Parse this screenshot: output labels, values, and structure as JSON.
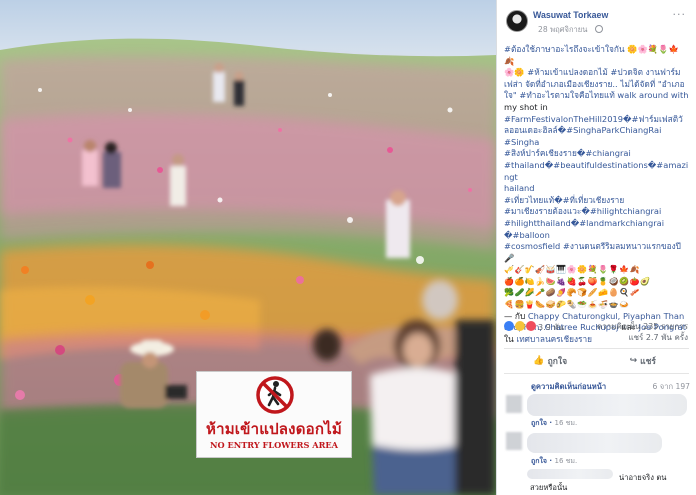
{
  "post": {
    "author": "Wasuwat Torkaew",
    "date": "28 พฤศจิกายน",
    "more_icon": "ellipsis-icon",
    "text_lines": [
      {
        "t": "#ต้องใช้ภาษาอะไรถึงจะเข้าใจกัน 🌼🌸💐🌷🍁🍂",
        "c": "tag"
      },
      {
        "t": "🌸🌼 #ห้ามเข้าแปลงดอกไม้ #ปวดจิต งานฟาร์ม",
        "c": "tag"
      },
      {
        "t": "เฟส่า จัดที่อำเภอเมืองเชียงราย.. ไม่ได้จัดที่ \"อำเภอ",
        "c": "tag"
      },
      {
        "t": "ใจ\" #ทำอะไรตามใจคือไทยแท้ walk around with",
        "c": "tag"
      },
      {
        "t": "my shot in",
        "c": "plain"
      },
      {
        "t": "#FarmFestivalonTheHill2019�#ฟาร์มเฟสติวั",
        "c": "tag"
      },
      {
        "t": "ลออนเดอะฮิลล์�#SinghaParkChiangRai",
        "c": "tag"
      },
      {
        "t": "#Singha",
        "c": "tag"
      },
      {
        "t": "#สิงห์ปาร์คเชียงราย�#chiangrai",
        "c": "tag"
      },
      {
        "t": "#thailand�#beautifuldestinations�#amazingt",
        "c": "tag"
      },
      {
        "t": "hailand",
        "c": "tag"
      },
      {
        "t": "#เที่ยวไทยแท้�#ที่เที่ยวเชียงราย",
        "c": "tag"
      },
      {
        "t": "#มาเชียงรายต้องแวะ�#hilightchiangrai",
        "c": "tag"
      },
      {
        "t": "#hilightthailand�#landmarkchiangrai",
        "c": "tag"
      },
      {
        "t": "�#balloon",
        "c": "tag"
      },
      {
        "t": "#cosmosfield #งานดนตรีริมลมหนาวแรกของปี 🎤",
        "c": "tag"
      }
    ],
    "emoji_lines": [
      "🎺🎸🎷🎻🥁🎹🌸🌼💐🌷🌹🍁🍂",
      "🍎🍊🍋🍌🍉🍇🍓🍒🍑🍍🥥🥝🍅🥑",
      "🥦🥒🌽🥕🥔🍠🥐🍞🥖🧀🥚🍳🥓",
      "🍕🍔🍟🌭🥪🌮🌯🥗🍝🍜🍲🍛"
    ],
    "with_prefix": "— กับ",
    "with_people": "Chappy Chaturongkul, Piyaphan Thanasophon, Chatree Ruchupoj",
    "with_and": "และ",
    "with_last": "Joe Pongrat",
    "at_prefix": "ใน",
    "place": "เทศบาลนครเชียงราย",
    "reactions_count": "3.9 พัน",
    "comments_count": "ความคิดเห็น 235 รายการ",
    "shares_count": "แชร์ 2.7 พัน ครั้ง",
    "like_label": "ถูกใจ",
    "share_label": "แชร์",
    "view_more_comments": "ดูความคิดเห็นก่อนหน้า",
    "comment_pager": "6 จาก 197",
    "comments": [
      {
        "like": "ถูกใจ",
        "time": "16 ชม."
      },
      {
        "like": "ถูกใจ",
        "time": "16 ชม."
      },
      {
        "tail": "น่าอายจริง ตน"
      },
      {
        "tail": "สวยหรือนั้น"
      }
    ]
  },
  "sign": {
    "thai": "ห้ามเข้าแปลงดอกไม้",
    "english": "NO ENTRY FLOWERS AREA",
    "icon": "no-pedestrian-icon"
  },
  "colors": {
    "link": "#385898",
    "sign_red": "#c0171c",
    "facebook_blue": "#3a7ff5"
  }
}
